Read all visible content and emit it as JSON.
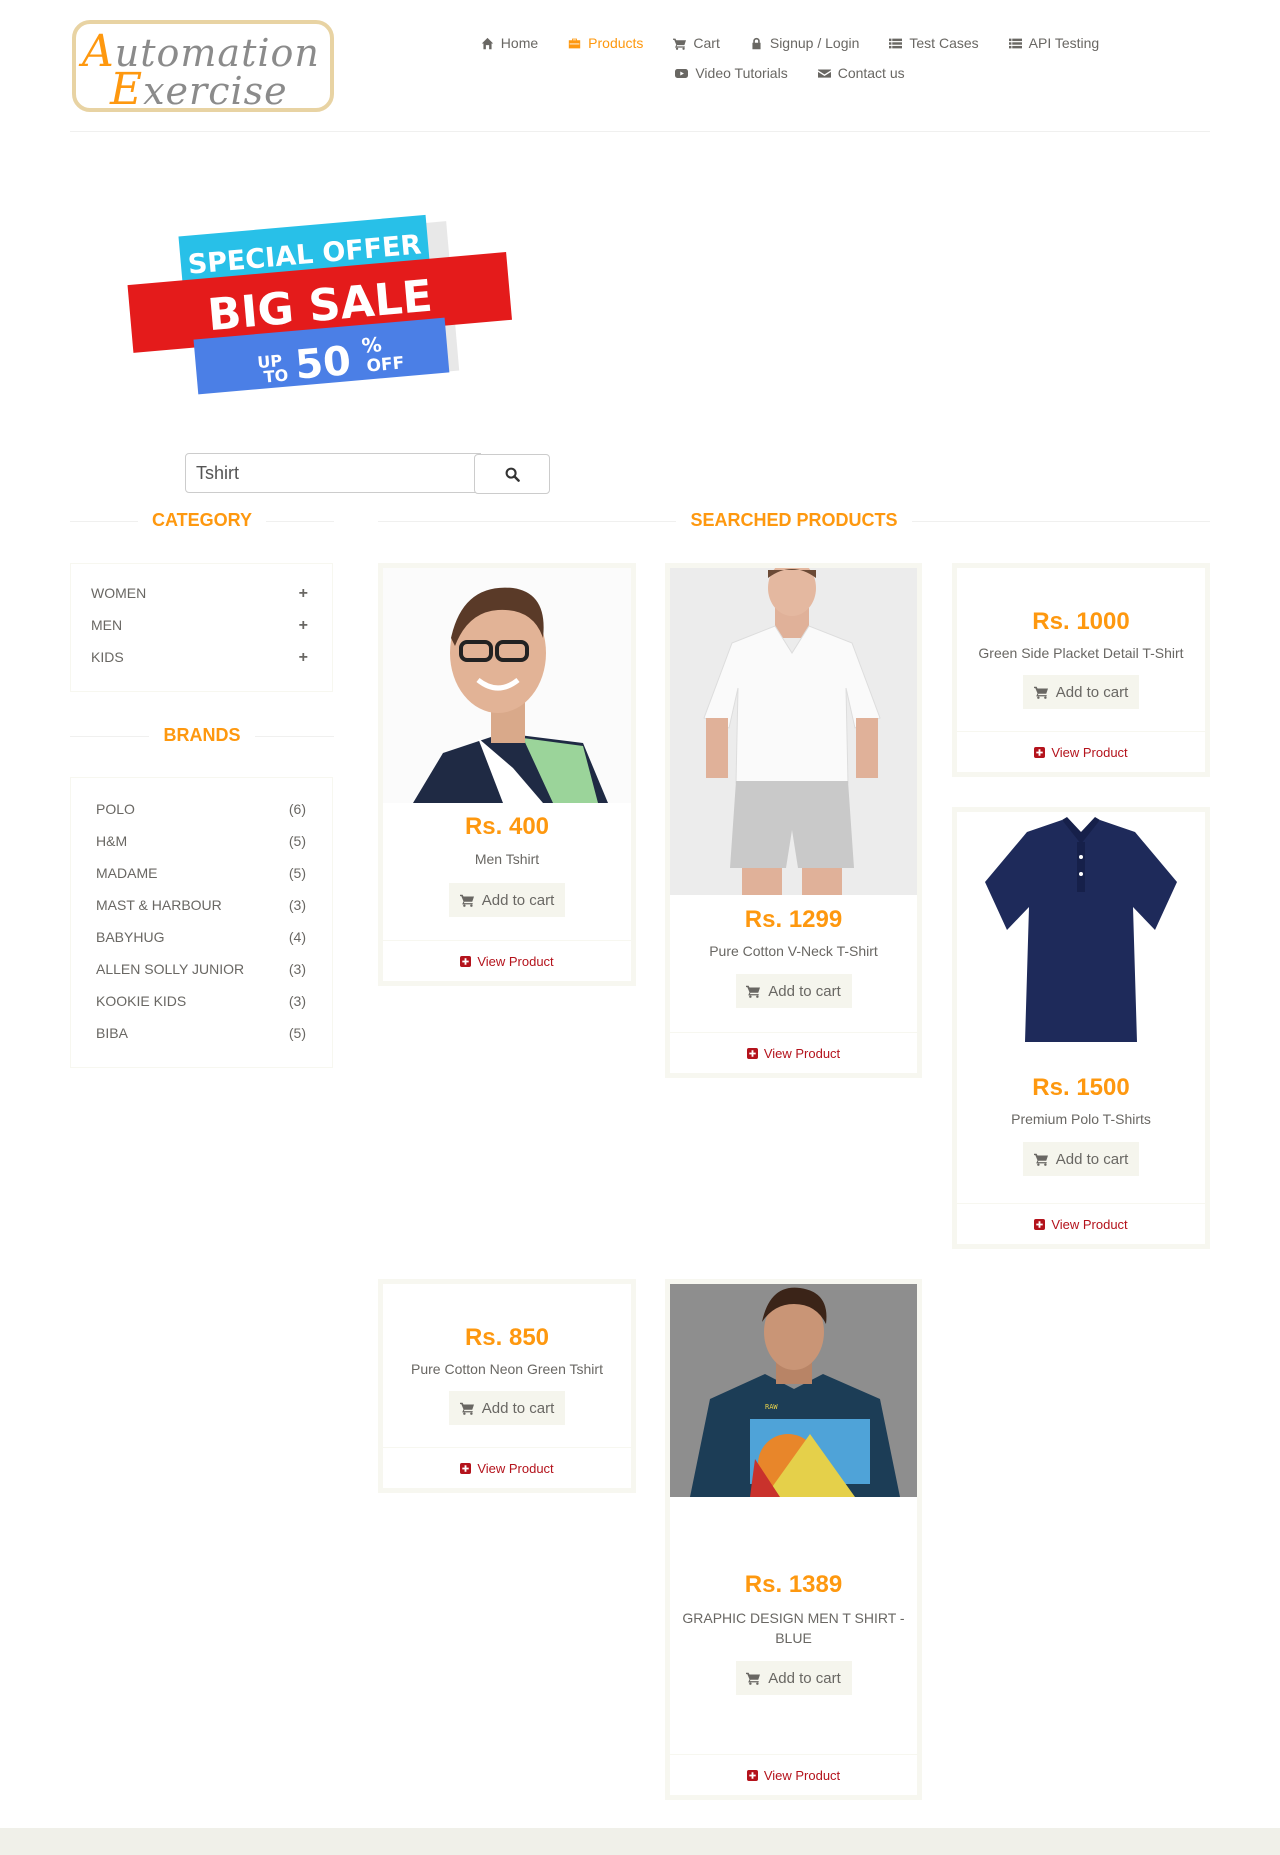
{
  "logo": {
    "line1_first": "A",
    "line1_rest": "utomation",
    "line2_first": "E",
    "line2_rest": "xercise"
  },
  "nav": {
    "items": [
      {
        "label": "Home",
        "icon": "home-icon"
      },
      {
        "label": "Products",
        "icon": "products-icon",
        "active": true
      },
      {
        "label": "Cart",
        "icon": "cart-icon"
      },
      {
        "label": "Signup / Login",
        "icon": "lock-icon"
      },
      {
        "label": "Test Cases",
        "icon": "list-icon"
      },
      {
        "label": "API Testing",
        "icon": "list-icon"
      },
      {
        "label": "Video Tutorials",
        "icon": "youtube-icon"
      },
      {
        "label": "Contact us",
        "icon": "envelope-icon"
      }
    ]
  },
  "banner": {
    "line1": "SPECIAL OFFER",
    "line2": "BIG SALE",
    "up": "UP",
    "to": "TO",
    "pct": "50",
    "percent_sign": "%",
    "off": "OFF"
  },
  "search": {
    "value": "Tshirt",
    "icon": "search-icon"
  },
  "category": {
    "title": "CATEGORY",
    "items": [
      {
        "label": "WOMEN"
      },
      {
        "label": "MEN"
      },
      {
        "label": "KIDS"
      }
    ],
    "expand_symbol": "+"
  },
  "brands": {
    "title": "BRANDS",
    "items": [
      {
        "name": "POLO",
        "count": "(6)"
      },
      {
        "name": "H&M",
        "count": "(5)"
      },
      {
        "name": "MADAME",
        "count": "(5)"
      },
      {
        "name": "MAST & HARBOUR",
        "count": "(3)"
      },
      {
        "name": "BABYHUG",
        "count": "(4)"
      },
      {
        "name": "ALLEN SOLLY JUNIOR",
        "count": "(3)"
      },
      {
        "name": "KOOKIE KIDS",
        "count": "(3)"
      },
      {
        "name": "BIBA",
        "count": "(5)"
      }
    ]
  },
  "products": {
    "title": "SEARCHED PRODUCTS",
    "add_to_cart": "Add to cart",
    "view_product": "View Product",
    "items": [
      {
        "price": "Rs. 400",
        "name": "Men Tshirt"
      },
      {
        "price": "Rs. 1299",
        "name": "Pure Cotton V-Neck T-Shirt"
      },
      {
        "price": "Rs. 1000",
        "name": "Green Side Placket Detail T-Shirt"
      },
      {
        "price": "Rs. 1500",
        "name": "Premium Polo T-Shirts"
      },
      {
        "price": "Rs. 850",
        "name": "Pure Cotton Neon Green Tshirt"
      },
      {
        "price": "Rs. 1389",
        "name": "GRAPHIC DESIGN MEN T SHIRT - BLUE"
      }
    ]
  },
  "colors": {
    "accent": "#fe980f",
    "link": "#b4131c",
    "text": "#696763"
  }
}
